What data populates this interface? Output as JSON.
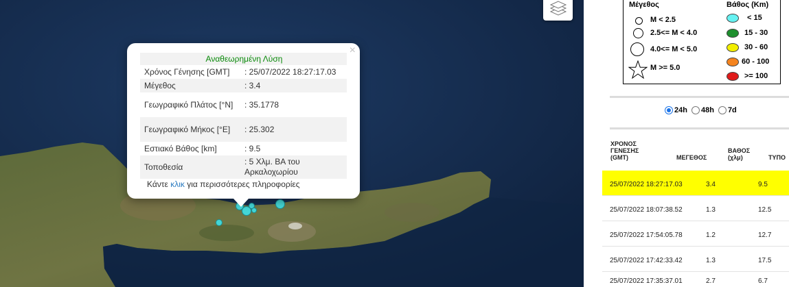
{
  "popup": {
    "title": "Αναθεωρημένη Λύση",
    "close": "×",
    "rows": [
      {
        "label": "Χρόνος Γένησης [GMT]",
        "value": ": 25/07/2022 18:27:17.03"
      },
      {
        "label": "Μέγεθος",
        "value": ": 3.4"
      },
      {
        "label": "Γεωγραφικό Πλάτος [°N]",
        "value": ": 35.1778"
      },
      {
        "label": "Γεωγραφικό Μήκος [°E]",
        "value": ": 25.302"
      },
      {
        "label": "Εστιακό Βάθος [km]",
        "value": ": 9.5"
      },
      {
        "label": "Τοποθεσία",
        "value": ": 5 Χλμ. ΒΑ του Αρκαλοχωρίου"
      }
    ],
    "more_before": "Κάντε ",
    "more_link": "κλικ",
    "more_after": " για περισσότερες πληροφορίες"
  },
  "legend": {
    "magnitude_title": "Μέγεθος",
    "magnitude_items": [
      "M < 2.5",
      "2.5<= M < 4.0",
      "4.0<= M < 5.0",
      "M >= 5.0"
    ],
    "depth_title": "Βάθος (Km)",
    "depth_items": [
      {
        "label": "< 15",
        "color": "#66f2f2"
      },
      {
        "label": "15 - 30",
        "color": "#1e8f2e"
      },
      {
        "label": "30 - 60",
        "color": "#f2ee00"
      },
      {
        "label": "60 - 100",
        "color": "#f5841f"
      },
      {
        "label": ">= 100",
        "color": "#e01b1b"
      }
    ]
  },
  "time_filter": {
    "options": [
      "24h",
      "48h",
      "7d"
    ],
    "selected": "24h"
  },
  "table": {
    "headers": {
      "time": [
        "ΧΡΟΝΟΣ",
        "ΓΕΝΕΣΗΣ",
        "(GMT)"
      ],
      "magnitude": "ΜΕΓΕΘΟΣ",
      "depth": [
        "ΒΑΘΟΣ",
        "(χλμ)"
      ],
      "location": "ΤΥΠΟ"
    },
    "rows": [
      {
        "time": "25/07/2022 18:27:17.03",
        "magnitude": "3.4",
        "depth": "9.5"
      },
      {
        "time": "25/07/2022 18:07:38.52",
        "magnitude": "1.3",
        "depth": "12.5"
      },
      {
        "time": "25/07/2022 17:54:05.78",
        "magnitude": "1.2",
        "depth": "12.7"
      },
      {
        "time": "25/07/2022 17:42:33.42",
        "magnitude": "1.3",
        "depth": "17.5"
      },
      {
        "time": "25/07/2022 17:35:37.01",
        "magnitude": "2.7",
        "depth": "6.7"
      }
    ],
    "selected_row_color": "#ffff00"
  },
  "colors": {
    "sea": "#14294a",
    "quake_marker": "#44d6d6"
  },
  "icons": {
    "layers": "layers-icon",
    "close": "close-icon",
    "magnitude_star": "star-icon"
  }
}
